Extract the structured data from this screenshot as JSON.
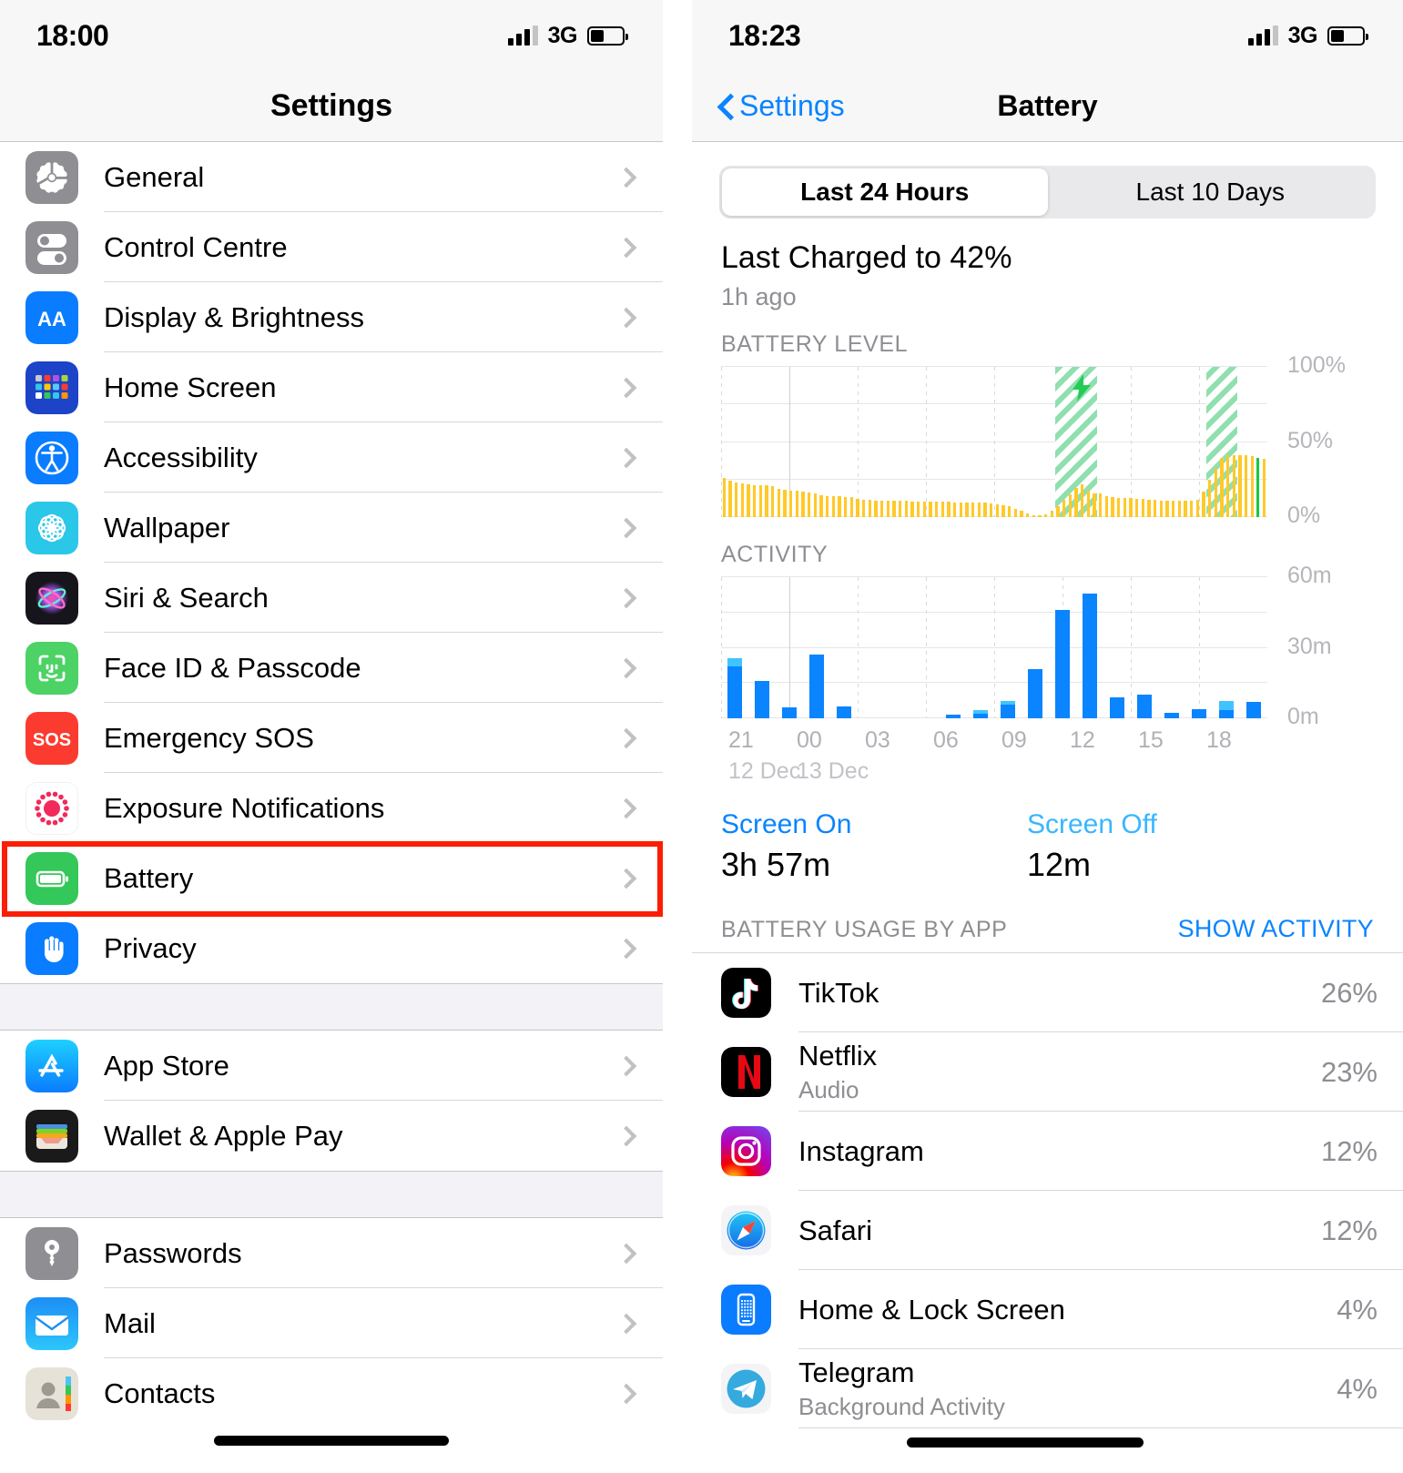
{
  "left": {
    "status": {
      "time": "18:00",
      "network": "3G"
    },
    "title": "Settings",
    "groups": [
      {
        "items": [
          {
            "label": "General",
            "icon": "gear-icon"
          },
          {
            "label": "Control Centre",
            "icon": "control-centre-icon"
          },
          {
            "label": "Display & Brightness",
            "icon": "display-brightness-icon"
          },
          {
            "label": "Home Screen",
            "icon": "home-screen-icon"
          },
          {
            "label": "Accessibility",
            "icon": "accessibility-icon"
          },
          {
            "label": "Wallpaper",
            "icon": "wallpaper-icon"
          },
          {
            "label": "Siri & Search",
            "icon": "siri-icon"
          },
          {
            "label": "Face ID & Passcode",
            "icon": "face-id-icon"
          },
          {
            "label": "Emergency SOS",
            "icon": "sos-icon"
          },
          {
            "label": "Exposure Notifications",
            "icon": "exposure-notifications-icon"
          },
          {
            "label": "Battery",
            "icon": "battery-icon",
            "highlighted": true
          },
          {
            "label": "Privacy",
            "icon": "privacy-hand-icon"
          }
        ]
      },
      {
        "items": [
          {
            "label": "App Store",
            "icon": "app-store-icon"
          },
          {
            "label": "Wallet & Apple Pay",
            "icon": "wallet-icon"
          }
        ]
      },
      {
        "items": [
          {
            "label": "Passwords",
            "icon": "passwords-key-icon"
          },
          {
            "label": "Mail",
            "icon": "mail-icon"
          },
          {
            "label": "Contacts",
            "icon": "contacts-icon"
          }
        ]
      }
    ],
    "highlight_color": "#fb1e05"
  },
  "right": {
    "status": {
      "time": "18:23",
      "network": "3G"
    },
    "back_label": "Settings",
    "title": "Battery",
    "segments": [
      {
        "label": "Last 24 Hours",
        "active": true
      },
      {
        "label": "Last 10 Days",
        "active": false
      }
    ],
    "last_charged_title": "Last Charged to 42%",
    "last_charged_sub": "1h ago",
    "battery_level_label": "BATTERY LEVEL",
    "activity_label": "ACTIVITY",
    "screen_on": {
      "key": "Screen On",
      "value": "3h 57m",
      "color": "#0a84ff"
    },
    "screen_off": {
      "key": "Screen Off",
      "value": "12m",
      "color": "#38b6ff"
    },
    "usage_header": "BATTERY USAGE BY APP",
    "show_activity": "SHOW ACTIVITY",
    "apps": [
      {
        "name": "TikTok",
        "sub": "",
        "pct": "26%",
        "icon": "tiktok-icon"
      },
      {
        "name": "Netflix",
        "sub": "Audio",
        "pct": "23%",
        "icon": "netflix-icon"
      },
      {
        "name": "Instagram",
        "sub": "",
        "pct": "12%",
        "icon": "instagram-icon"
      },
      {
        "name": "Safari",
        "sub": "",
        "pct": "12%",
        "icon": "safari-icon"
      },
      {
        "name": "Home & Lock Screen",
        "sub": "",
        "pct": "4%",
        "icon": "home-lock-screen-icon"
      },
      {
        "name": "Telegram",
        "sub": "Background Activity",
        "pct": "4%",
        "icon": "telegram-icon"
      }
    ]
  },
  "chart_data": [
    {
      "type": "bar",
      "title": "BATTERY LEVEL",
      "ylabel": "",
      "xlabel": "",
      "ylim": [
        0,
        100
      ],
      "yticks": [
        "0%",
        "50%",
        "100%"
      ],
      "xticks": [
        "21",
        "00",
        "03",
        "06",
        "09",
        "12",
        "15",
        "18"
      ],
      "xtick_dates": [
        "12 Dec",
        "13 Dec"
      ],
      "bar_color": "#ffc928",
      "charging_color": "#8fe0ae",
      "current_marker_color": "#13c943",
      "values": [
        26,
        24,
        23,
        22.5,
        22,
        21.5,
        21,
        21,
        20.5,
        18.5,
        18,
        17.5,
        17.5,
        17,
        16.5,
        16,
        14.5,
        14,
        14,
        14,
        13.5,
        13.5,
        12,
        11.5,
        11.5,
        11,
        11,
        11,
        11,
        11,
        11,
        10.5,
        10.5,
        10.5,
        10.5,
        10.5,
        10.5,
        10.5,
        10,
        10,
        10,
        10,
        9.5,
        9.5,
        9,
        8.5,
        8,
        7,
        5.5,
        4,
        2.5,
        1.5,
        1.2,
        1.8,
        4.5,
        7.5,
        11.5,
        15,
        19.5,
        22,
        17.5,
        16,
        15.5,
        14,
        13.5,
        13,
        13,
        12.5,
        12,
        12,
        11.5,
        11.5,
        11,
        11,
        11,
        11,
        11,
        11,
        11.5,
        17,
        25,
        33,
        39.5,
        41,
        41.5,
        41.5,
        41,
        40.5,
        39.5,
        38.5
      ],
      "charging_bands": [
        {
          "start_index": 55,
          "end_index": 61
        },
        {
          "start_index": 80,
          "end_index": 84
        }
      ]
    },
    {
      "type": "bar",
      "title": "ACTIVITY",
      "ylabel": "",
      "xlabel": "",
      "ylim": [
        0,
        60
      ],
      "yticks": [
        "0m",
        "30m",
        "60m"
      ],
      "xticks": [
        "21",
        "00",
        "03",
        "06",
        "09",
        "12",
        "15",
        "18"
      ],
      "xtick_dates": [
        "12 Dec",
        "13 Dec"
      ],
      "series": [
        {
          "name": "Screen On",
          "color": "#0a84ff",
          "values": [
            22,
            16,
            4.5,
            27,
            5,
            0,
            0,
            0,
            1.5,
            2,
            6,
            21,
            46,
            53,
            9,
            10,
            2.5,
            4,
            3.5,
            7
          ]
        },
        {
          "name": "Screen Off",
          "color": "#40c4ff",
          "values": [
            3.5,
            0,
            0,
            0,
            0,
            0,
            0,
            0,
            0,
            1.5,
            1.5,
            0,
            0,
            0,
            0,
            0,
            0,
            0,
            4,
            0
          ]
        }
      ]
    }
  ]
}
